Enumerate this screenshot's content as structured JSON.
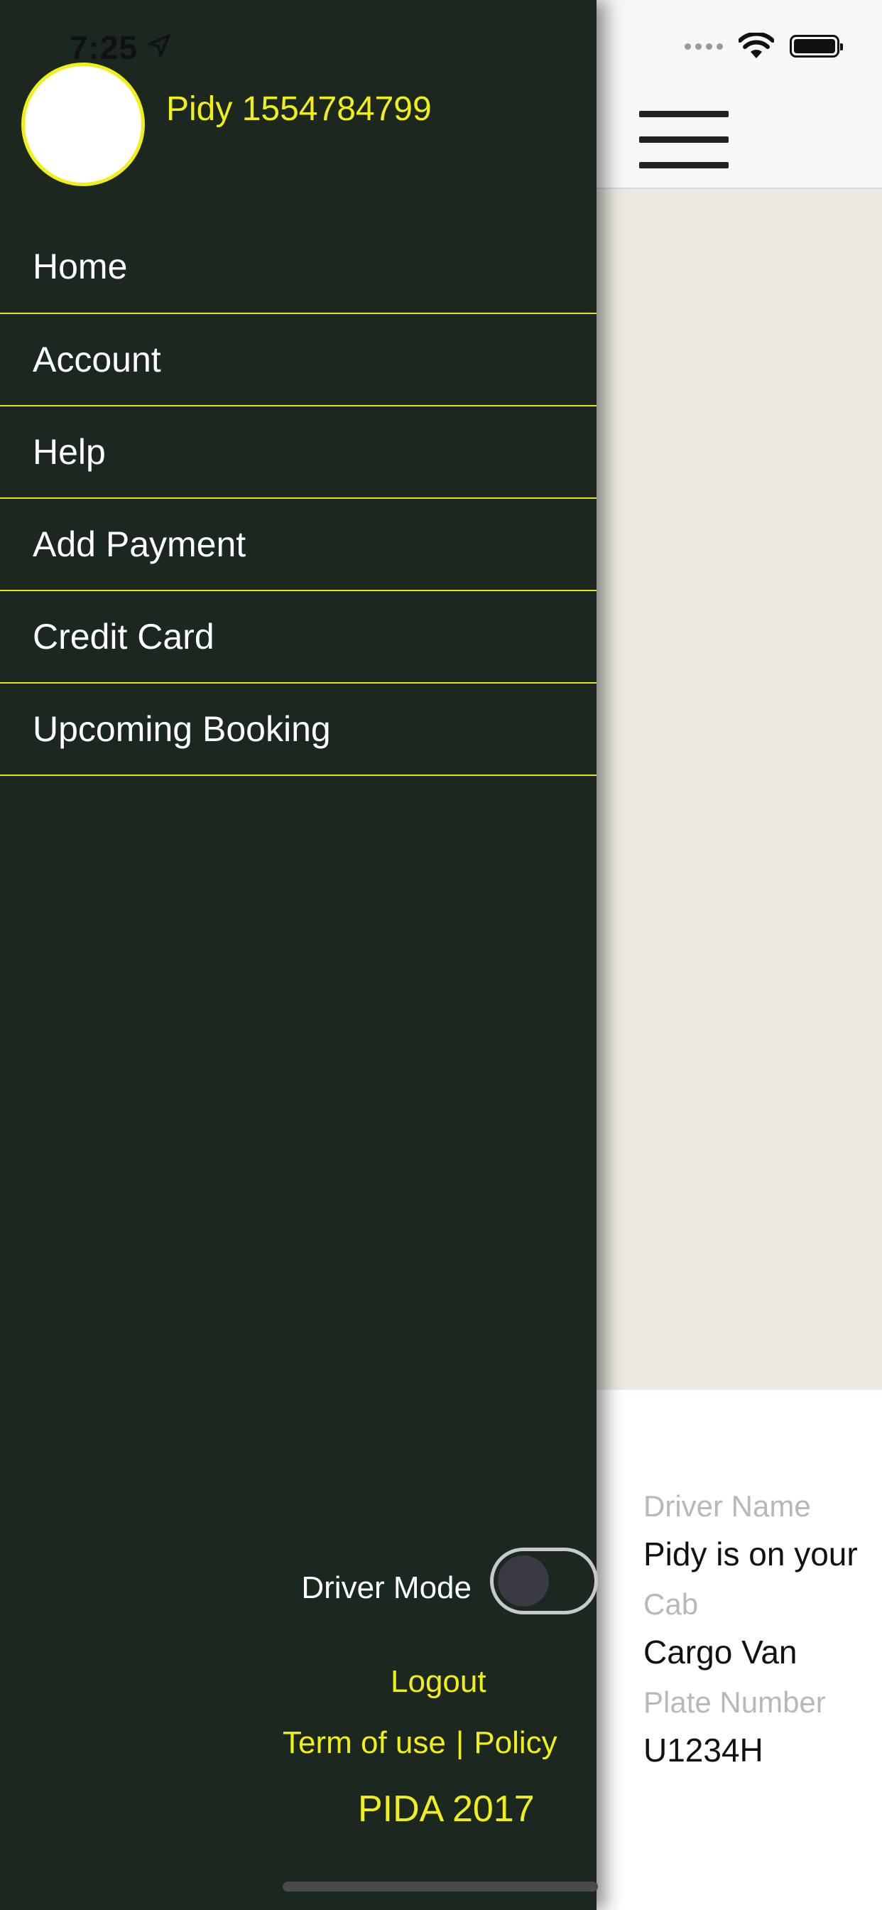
{
  "status_bar": {
    "time": "7:25",
    "location_icon": "location-arrow-icon",
    "signal_icon": "cellular-signal-icon",
    "wifi_icon": "wifi-icon",
    "battery_icon": "battery-icon"
  },
  "drawer": {
    "avatar_icon": "profile-avatar",
    "user_name": "Pidy 1554784799",
    "menu_items": [
      {
        "label": "Home"
      },
      {
        "label": "Account"
      },
      {
        "label": "Help"
      },
      {
        "label": "Add Payment"
      },
      {
        "label": "Credit Card"
      },
      {
        "label": "Upcoming Booking"
      }
    ],
    "driver_mode_label": "Driver Mode",
    "driver_mode_on": false,
    "logout_label": "Logout",
    "terms_label": "Term of use",
    "separator": "|",
    "policy_label": "Policy",
    "brand_label": "PIDA 2017"
  },
  "main": {
    "menu_icon": "hamburger-menu-icon",
    "driver_name_label": "Driver Name",
    "driver_name_value": "Pidy is on your",
    "cab_label": "Cab",
    "cab_value": "Cargo Van",
    "plate_label": "Plate Number",
    "plate_value": "U1234H"
  },
  "colors": {
    "drawer_bg": "#1b271f",
    "accent_yellow": "#f0f018",
    "map_bg": "#ece9e2"
  }
}
